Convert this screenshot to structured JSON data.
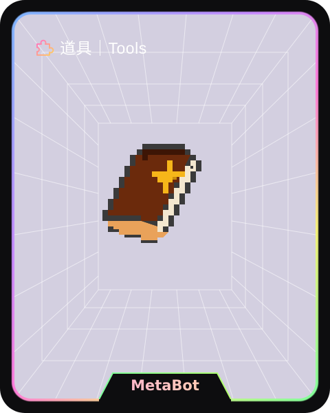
{
  "card": {
    "category_icon": "puzzle-piece-icon",
    "title": "道具｜Tools",
    "item_image": "pixel-book-icon",
    "brand_label": "MetaBot"
  },
  "colors": {
    "background": "#d3cfe0",
    "frame": "#0d0d0f",
    "book_cover": "#6b2a0c",
    "book_pages": "#f3e7cf",
    "book_edge": "#e9a25a",
    "cross": "#f6b619"
  }
}
